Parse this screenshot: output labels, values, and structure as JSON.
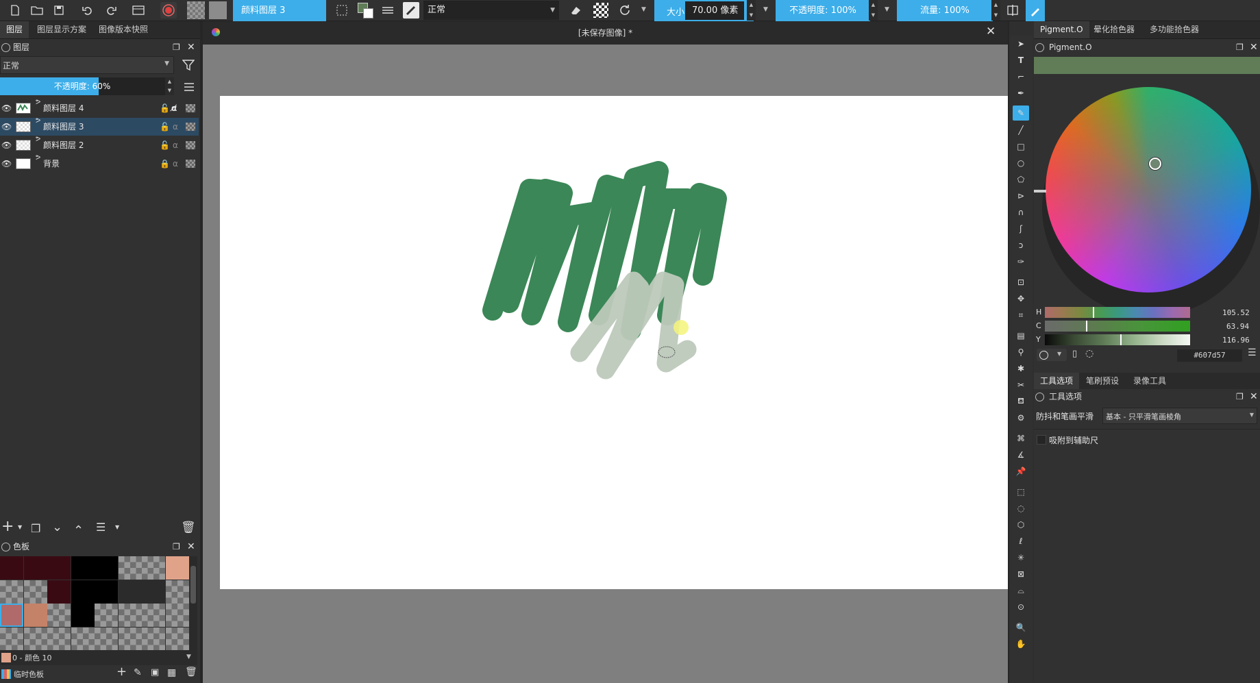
{
  "toolbar": {
    "layer_name_field": "颜料图层 3",
    "blend_mode": "正常",
    "size_label": "大小:",
    "size_value": "70.00 像素",
    "opacity_label": "不透明度: 100%",
    "flow_label": "流量: 100%"
  },
  "left_dock": {
    "tabs": [
      "图层",
      "图层显示方案",
      "图像版本快照"
    ],
    "layers_panel_title": "图层",
    "blend_mode": "正常",
    "opacity_label": "不透明度: 60%",
    "opacity_percent": 60,
    "layers": [
      {
        "name": "颜料图层 4",
        "selected": false
      },
      {
        "name": "颜料图层 3",
        "selected": true
      },
      {
        "name": "颜料图层 2",
        "selected": false
      },
      {
        "name": "背景",
        "selected": false
      }
    ],
    "palette_title": "色板",
    "palette_current": "0 - 颜色 10",
    "palette_name": "临时色板",
    "palette_colors": [
      "#3a0a12",
      "#3a0a12",
      "#3a0a12",
      "#000000",
      "#000000",
      "checker",
      "checker",
      "#e0a38a",
      "checker",
      "checker",
      "#3a0a12",
      "#000000",
      "#000000",
      "#2b2b2b",
      "#2b2b2b",
      "checker",
      "#b06a6a",
      "#c48268",
      "checker",
      "#000000",
      "checker",
      "checker",
      "checker",
      "checker",
      "checker",
      "checker",
      "checker",
      "checker",
      "checker",
      "checker",
      "checker",
      "checker"
    ]
  },
  "canvas": {
    "tab_title": "[未保存图像]  *"
  },
  "right_dock": {
    "tabs": [
      "Pigment.O",
      "晕化拾色器",
      "多功能拾色器"
    ],
    "pigment_title": "Pigment.O",
    "current_color": "#607d57",
    "hcy": [
      {
        "label": "H",
        "value": "105.52"
      },
      {
        "label": "C",
        "value": "63.94"
      },
      {
        "label": "Y",
        "value": "116.96"
      }
    ],
    "hex_value": "#607d57",
    "tool_tabs": [
      "工具选项",
      "笔刷预设",
      "录像工具"
    ],
    "tool_options_title": "工具选项",
    "smoothing_label": "防抖和笔画平滑",
    "smoothing_value": "基本 - 只平滑笔画棱角",
    "snap_label": "吸附到辅助尺"
  },
  "colors": {
    "accent": "#3daee9",
    "stroke_dark": "#3b8757",
    "stroke_light": "#bdc9ba"
  }
}
